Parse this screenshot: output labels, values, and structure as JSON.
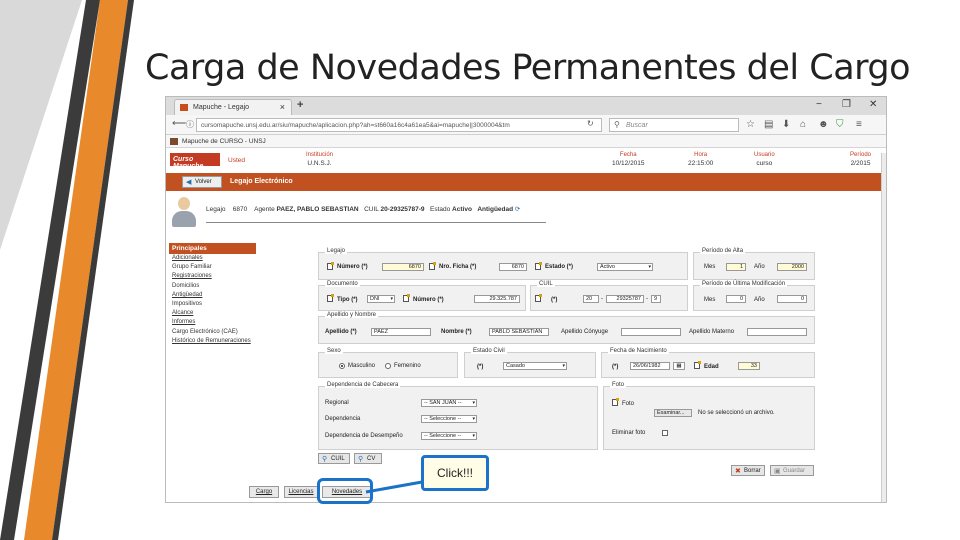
{
  "slide": {
    "title": "Carga de Novedades Permanentes del Cargo"
  },
  "browser": {
    "tab_title": "Mapuche - Legajo",
    "tab_close": "×",
    "new_tab": "+",
    "window_controls": [
      "−",
      "❐",
      "✕"
    ],
    "url": "cursomapuche.unsj.edu.ar/siu/mapuche/aplicacion.php?ah=st660a16c4a61ea5&ai=mapuche||3000004&tm",
    "search_placeholder": "Buscar",
    "bookmark": "Mapuche de CURSO - UNSJ"
  },
  "app_header": {
    "logo": "Curso Mapuche",
    "user": "Usted",
    "columns": [
      {
        "label": "Institución",
        "value": "U.N.S.J."
      },
      {
        "label": "Fecha",
        "value": "10/12/2015"
      },
      {
        "label": "Hora",
        "value": "22:15:00"
      },
      {
        "label": "Usuario",
        "value": "curso"
      },
      {
        "label": "Período",
        "value": "2/2015"
      }
    ]
  },
  "toolbar": {
    "back_label": "Volver",
    "section_title": "Legajo Electrónico"
  },
  "agent_info": {
    "legajo_label": "Legajo",
    "legajo_value": "6870",
    "agente_label": "Agente",
    "agente_value": "PAEZ, PABLO SEBASTIAN",
    "cuil_label": "CUIL",
    "cuil_value": "20-29325787-9",
    "estado_label": "Estado",
    "estado_value": "Activo",
    "antiguedad_label": "Antigüedad"
  },
  "side_menu": {
    "header": "Principales",
    "items": [
      "Adicionales",
      "Grupo Familiar",
      "Registraciones",
      "Domicilios",
      "Antigüedad",
      "Impositivos",
      "Alcance",
      "Informes",
      "Cargo Electrónico (CAE)",
      "Histórico de Remuneraciones"
    ]
  },
  "form": {
    "legajo": {
      "legend": "Legajo",
      "numero_label": "Número (*)",
      "numero_value": "6870",
      "ficha_label": "Nro. Ficha (*)",
      "ficha_value": "6870",
      "estado_label": "Estado (*)",
      "estado_value": "Activo"
    },
    "periodo_alta": {
      "legend": "Período de Alta",
      "mes_label": "Mes",
      "mes_value": "1",
      "anio_label": "Año",
      "anio_value": "2000"
    },
    "documento": {
      "legend": "Documento",
      "tipo_label": "Tipo (*)",
      "tipo_value": "DNI",
      "numero_label": "Número (*)",
      "numero_value": "29.325.787"
    },
    "cuil": {
      "legend": "CUIL",
      "label": "(*)",
      "prefix": "20",
      "middle": "29325787",
      "suffix": "9"
    },
    "periodo_mod": {
      "legend": "Período de Última Modificación",
      "mes_label": "Mes",
      "mes_value": "0",
      "anio_label": "Año",
      "anio_value": "0"
    },
    "nombre": {
      "legend": "Apellido y Nombre",
      "apellido_label": "Apellido (*)",
      "apellido_value": "PAEZ",
      "nombre_label": "Nombre (*)",
      "nombre_value": "PABLO SEBASTIAN",
      "conyuge_label": "Apellido Cónyuge",
      "conyuge_value": "",
      "materno_label": "Apellido Materno",
      "materno_value": ""
    },
    "sexo": {
      "legend": "Sexo",
      "masculino": "Masculino",
      "femenino": "Femenino"
    },
    "estado_civil": {
      "legend": "Estado Civil",
      "label": "(*)",
      "value": "Casado"
    },
    "nacimiento": {
      "legend": "Fecha de Nacimiento",
      "label": "(*)",
      "value": "26/06/1982",
      "edad_label": "Edad",
      "edad_value": "33"
    },
    "dependencia": {
      "legend": "Dependencia de Cabecera",
      "region_label": "Regional",
      "region_value": "-- SAN JUAN --",
      "dependencia_label": "Dependencia",
      "dependencia_value": "-- Seleccione --",
      "desempeno_label": "Dependencia de Desempeño",
      "desempeno_value": "-- Seleccione --"
    },
    "foto": {
      "legend": "Foto",
      "foto_label": "Foto",
      "examinar_label": "Examinar...",
      "no_file_text": "No se seleccionó un archivo.",
      "eliminar_label": "Eliminar foto"
    }
  },
  "buttons": {
    "cuil": "CUIL",
    "cv": "CV",
    "borrar": "Borrar",
    "guardar": "Guardar"
  },
  "bottom_tabs": [
    "Cargo",
    "Licencias",
    "Novedades"
  ],
  "callout": {
    "text": "Click!!!"
  },
  "colors": {
    "brand_orange": "#c25121",
    "highlight_blue": "#1a73c9",
    "deco_gray": "#3b3b3b",
    "deco_orange": "#e8892b"
  }
}
